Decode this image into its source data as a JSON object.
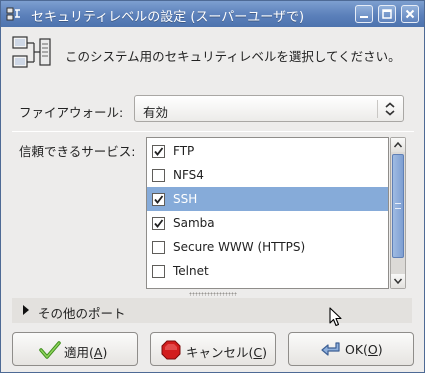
{
  "window": {
    "title": "セキュリティレベルの設定 (スーパーユーザで)",
    "controls": [
      "minimize",
      "maximize",
      "close"
    ],
    "title_bar_color": "#5b80ba"
  },
  "header": {
    "icon": "network-security-icon",
    "text": "このシステム用のセキュリティレベルを選択してください。"
  },
  "firewall": {
    "label": "ファイアウォール:",
    "value": "有効"
  },
  "services": {
    "label": "信頼できるサービス:",
    "items": [
      {
        "name": "FTP",
        "checked": true,
        "selected": false
      },
      {
        "name": "NFS4",
        "checked": false,
        "selected": false
      },
      {
        "name": "SSH",
        "checked": true,
        "selected": true
      },
      {
        "name": "Samba",
        "checked": true,
        "selected": false
      },
      {
        "name": "Secure WWW (HTTPS)",
        "checked": false,
        "selected": false
      },
      {
        "name": "Telnet",
        "checked": false,
        "selected": false
      }
    ],
    "selection_color": "#86abd9"
  },
  "other_ports": {
    "label": "その他のポート"
  },
  "buttons": {
    "apply": {
      "pre": "適用(",
      "key": "A",
      "post": ")",
      "icon": "checkmark-icon"
    },
    "cancel": {
      "pre": "キャンセル(",
      "key": "C",
      "post": ")",
      "icon": "stop-icon"
    },
    "ok": {
      "pre": "OK(",
      "key": "O",
      "post": ")",
      "icon": "return-arrow-icon"
    }
  }
}
